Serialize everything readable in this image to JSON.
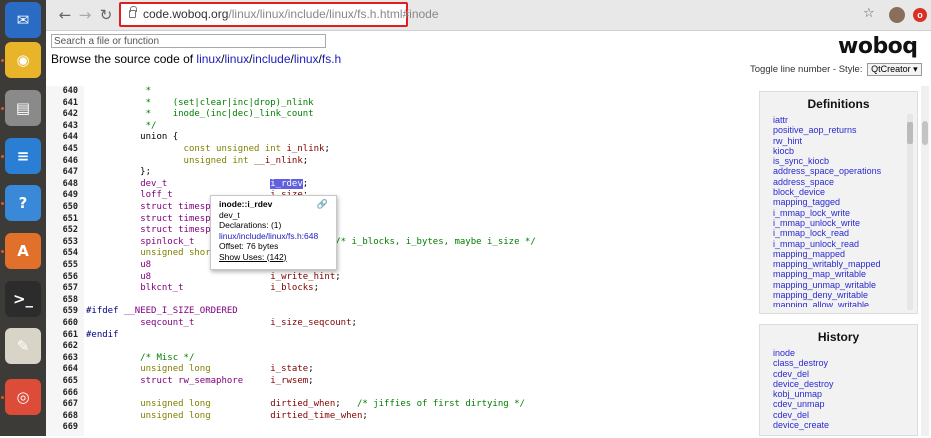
{
  "browser": {
    "url_domain": "code.woboq.org",
    "url_path": "/linux/linux/include/linux/fs.h.html#inode",
    "back_icon": "arrow-left",
    "forward_icon": "arrow-right",
    "reload_icon": "reload",
    "bookmark_icon": "star",
    "extension_badge": "o"
  },
  "page": {
    "search_placeholder": "Search a file or function",
    "browse_prefix": "Browse the source code of ",
    "breadcrumb": [
      "linux",
      "linux",
      "include",
      "linux",
      "fs.h"
    ],
    "logo": "woboq",
    "toggle_line_label": "Toggle line number",
    "style_label": " - Style:",
    "style_value": "QtCreator ▾"
  },
  "code": {
    "lines": [
      {
        "n": "640",
        "segs": [
          {
            "t": "           *",
            "c": "c-cm"
          }
        ]
      },
      {
        "n": "641",
        "segs": [
          {
            "t": "           *    (set|clear|inc|drop)_nlink",
            "c": "c-cm"
          }
        ]
      },
      {
        "n": "642",
        "segs": [
          {
            "t": "           *    inode_(inc|dec)_link_count",
            "c": "c-cm"
          }
        ]
      },
      {
        "n": "643",
        "segs": [
          {
            "t": "           */",
            "c": "c-cm"
          }
        ]
      },
      {
        "n": "644",
        "segs": [
          {
            "t": "          union {",
            "c": ""
          }
        ]
      },
      {
        "n": "645",
        "segs": [
          {
            "t": "                  ",
            "c": ""
          },
          {
            "t": "const unsigned int",
            "c": "c-kw"
          },
          {
            "t": " ",
            "c": ""
          },
          {
            "t": "i_nlink",
            "c": "c-mem"
          },
          {
            "t": ";",
            "c": ""
          }
        ]
      },
      {
        "n": "646",
        "segs": [
          {
            "t": "                  ",
            "c": ""
          },
          {
            "t": "unsigned int",
            "c": "c-kw"
          },
          {
            "t": " ",
            "c": ""
          },
          {
            "t": "__i_nlink",
            "c": "c-mem"
          },
          {
            "t": ";",
            "c": ""
          }
        ]
      },
      {
        "n": "647",
        "segs": [
          {
            "t": "          };",
            "c": ""
          }
        ]
      },
      {
        "n": "648",
        "segs": [
          {
            "t": "          ",
            "c": ""
          },
          {
            "t": "dev_t",
            "c": "c-ty"
          },
          {
            "t": "                   ",
            "c": ""
          },
          {
            "t": "i_rdev",
            "c": "hl"
          },
          {
            "t": ";",
            "c": ""
          }
        ]
      },
      {
        "n": "649",
        "segs": [
          {
            "t": "          ",
            "c": ""
          },
          {
            "t": "loff_t",
            "c": "c-ty"
          },
          {
            "t": "                  ",
            "c": ""
          },
          {
            "t": "i_size",
            "c": "c-mem"
          },
          {
            "t": ";",
            "c": ""
          }
        ]
      },
      {
        "n": "650",
        "segs": [
          {
            "t": "          ",
            "c": ""
          },
          {
            "t": "struct timespec64",
            "c": "c-ty"
          },
          {
            "t": "       ",
            "c": ""
          },
          {
            "t": "i_atime",
            "c": "c-mem"
          },
          {
            "t": ";",
            "c": ""
          }
        ]
      },
      {
        "n": "651",
        "segs": [
          {
            "t": "          ",
            "c": ""
          },
          {
            "t": "struct timespec64",
            "c": "c-ty"
          },
          {
            "t": "       ",
            "c": ""
          },
          {
            "t": "i_mtime",
            "c": "c-mem"
          },
          {
            "t": ";",
            "c": ""
          }
        ]
      },
      {
        "n": "652",
        "segs": [
          {
            "t": "          ",
            "c": ""
          },
          {
            "t": "struct timespec64",
            "c": "c-ty"
          },
          {
            "t": "       ",
            "c": ""
          },
          {
            "t": "i_ctime",
            "c": "c-mem"
          },
          {
            "t": ";",
            "c": ""
          }
        ]
      },
      {
        "n": "653",
        "segs": [
          {
            "t": "          ",
            "c": ""
          },
          {
            "t": "spinlock_t",
            "c": "c-ty"
          },
          {
            "t": "              ",
            "c": ""
          },
          {
            "t": "i_lock",
            "c": "c-mem"
          },
          {
            "t": ";     ",
            "c": ""
          },
          {
            "t": "/* i_blocks, i_bytes, maybe i_size */",
            "c": "c-cm"
          }
        ]
      },
      {
        "n": "654",
        "segs": [
          {
            "t": "          ",
            "c": ""
          },
          {
            "t": "unsigned short",
            "c": "c-kw"
          },
          {
            "t": "          ",
            "c": ""
          },
          {
            "t": "i_bytes",
            "c": "c-mem"
          },
          {
            "t": ";",
            "c": ""
          }
        ]
      },
      {
        "n": "655",
        "segs": [
          {
            "t": "          ",
            "c": ""
          },
          {
            "t": "u8",
            "c": "c-ty"
          },
          {
            "t": "                      ",
            "c": ""
          },
          {
            "t": "i_blkbits",
            "c": "c-mem"
          },
          {
            "t": ";",
            "c": ""
          }
        ]
      },
      {
        "n": "656",
        "segs": [
          {
            "t": "          ",
            "c": ""
          },
          {
            "t": "u8",
            "c": "c-ty"
          },
          {
            "t": "                      ",
            "c": ""
          },
          {
            "t": "i_write_hint",
            "c": "c-mem"
          },
          {
            "t": ";",
            "c": ""
          }
        ]
      },
      {
        "n": "657",
        "segs": [
          {
            "t": "          ",
            "c": ""
          },
          {
            "t": "blkcnt_t",
            "c": "c-ty"
          },
          {
            "t": "                ",
            "c": ""
          },
          {
            "t": "i_blocks",
            "c": "c-mem"
          },
          {
            "t": ";",
            "c": ""
          }
        ]
      },
      {
        "n": "658",
        "segs": [
          {
            "t": "",
            "c": ""
          }
        ]
      },
      {
        "n": "659",
        "segs": [
          {
            "t": "#ifdef ",
            "c": "c-pp"
          },
          {
            "t": "__NEED_I_SIZE_ORDERED",
            "c": "c-ty"
          }
        ]
      },
      {
        "n": "660",
        "segs": [
          {
            "t": "          ",
            "c": ""
          },
          {
            "t": "seqcount_t",
            "c": "c-ty"
          },
          {
            "t": "              ",
            "c": ""
          },
          {
            "t": "i_size_seqcount",
            "c": "c-mem"
          },
          {
            "t": ";",
            "c": ""
          }
        ]
      },
      {
        "n": "661",
        "segs": [
          {
            "t": "#endif",
            "c": "c-pp"
          }
        ]
      },
      {
        "n": "662",
        "segs": [
          {
            "t": "",
            "c": ""
          }
        ]
      },
      {
        "n": "663",
        "segs": [
          {
            "t": "          /* Misc */",
            "c": "c-cm"
          }
        ]
      },
      {
        "n": "664",
        "segs": [
          {
            "t": "          ",
            "c": ""
          },
          {
            "t": "unsigned long",
            "c": "c-kw"
          },
          {
            "t": "           ",
            "c": ""
          },
          {
            "t": "i_state",
            "c": "c-mem"
          },
          {
            "t": ";",
            "c": ""
          }
        ]
      },
      {
        "n": "665",
        "segs": [
          {
            "t": "          ",
            "c": ""
          },
          {
            "t": "struct rw_semaphore",
            "c": "c-ty"
          },
          {
            "t": "     ",
            "c": ""
          },
          {
            "t": "i_rwsem",
            "c": "c-mem"
          },
          {
            "t": ";",
            "c": ""
          }
        ]
      },
      {
        "n": "666",
        "segs": [
          {
            "t": "",
            "c": ""
          }
        ]
      },
      {
        "n": "667",
        "segs": [
          {
            "t": "          ",
            "c": ""
          },
          {
            "t": "unsigned long",
            "c": "c-kw"
          },
          {
            "t": "           ",
            "c": ""
          },
          {
            "t": "dirtied_when",
            "c": "c-mem"
          },
          {
            "t": ";   ",
            "c": ""
          },
          {
            "t": "/* jiffies of first dirtying */",
            "c": "c-cm"
          }
        ]
      },
      {
        "n": "668",
        "segs": [
          {
            "t": "          ",
            "c": ""
          },
          {
            "t": "unsigned long",
            "c": "c-kw"
          },
          {
            "t": "           ",
            "c": ""
          },
          {
            "t": "dirtied_time_when",
            "c": "c-mem"
          },
          {
            "t": ";",
            "c": ""
          }
        ]
      },
      {
        "n": "669",
        "segs": [
          {
            "t": "",
            "c": ""
          }
        ]
      }
    ]
  },
  "tooltip": {
    "title": "inode::i_rdev",
    "type": "dev_t",
    "declarations": "Declarations: (1)",
    "location": "linux/include/linux/fs.h:648",
    "offset": "Offset: 76 bytes",
    "uses": "Show Uses: (142)"
  },
  "definitions": {
    "title": "Definitions",
    "items": [
      "iattr",
      "positive_aop_returns",
      "rw_hint",
      "kiocb",
      "is_sync_kiocb",
      "address_space_operations",
      "address_space",
      "block_device",
      "mapping_tagged",
      "i_mmap_lock_write",
      "i_mmap_unlock_write",
      "i_mmap_lock_read",
      "i_mmap_unlock_read",
      "mapping_mapped",
      "mapping_writably_mapped",
      "mapping_map_writable",
      "mapping_unmap_writable",
      "mapping_deny_writable",
      "mapping_allow_writable"
    ]
  },
  "history": {
    "title": "History",
    "items": [
      "inode",
      "class_destroy",
      "cdev_del",
      "device_destroy",
      "kobj_unmap",
      "cdev_unmap",
      "cdev_del",
      "device_create"
    ]
  },
  "dock": {
    "apps": [
      {
        "name": "thunderbird-icon",
        "color": "#2a6cc4",
        "glyph": "✉"
      },
      {
        "name": "rhythmbox-icon",
        "color": "#e8b52a",
        "glyph": "◉"
      },
      {
        "name": "files-icon",
        "color": "#8a8a8a",
        "glyph": "▤"
      },
      {
        "name": "writer-icon",
        "color": "#2a7fd4",
        "glyph": "≡"
      },
      {
        "name": "help-icon",
        "color": "#3a88d8",
        "glyph": "?"
      },
      {
        "name": "software-center-icon",
        "color": "#e0702a",
        "glyph": "A"
      },
      {
        "name": "terminal-icon",
        "color": "#2c2c2c",
        "glyph": ">_"
      },
      {
        "name": "text-editor-icon",
        "color": "#d8d4c8",
        "glyph": "✎"
      },
      {
        "name": "chrome-icon",
        "color": "#dd4b39",
        "glyph": "◎"
      }
    ]
  }
}
